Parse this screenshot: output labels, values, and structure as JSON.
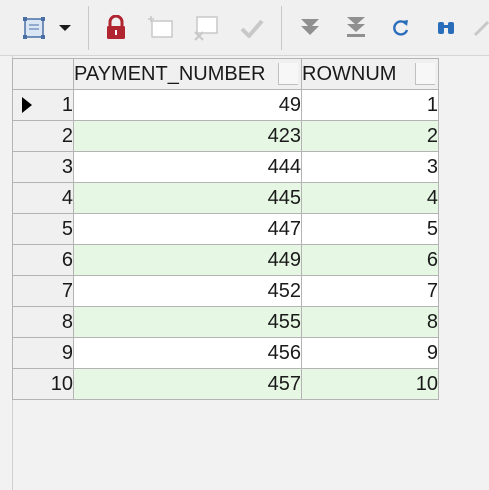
{
  "toolbar": {
    "icons": [
      "grid-select-icon",
      "dropdown-arrow-icon",
      "lock-icon",
      "insert-record-icon",
      "delete-record-icon",
      "post-edit-icon",
      "next-record-icon",
      "last-record-icon",
      "refresh-icon",
      "find-icon",
      "edit-icon"
    ],
    "colors": {
      "lock": "#b0252f",
      "nav": "#909090",
      "refresh": "#2a6ebb",
      "find": "#2a6ebb",
      "disabled": "#c8c8c8"
    }
  },
  "grid": {
    "columns": [
      "PAYMENT_NUMBER",
      "ROWNUM"
    ],
    "current_row": 1,
    "rows": [
      {
        "num": "1",
        "payment_number": "49",
        "rownum": "1"
      },
      {
        "num": "2",
        "payment_number": "423",
        "rownum": "2"
      },
      {
        "num": "3",
        "payment_number": "444",
        "rownum": "3"
      },
      {
        "num": "4",
        "payment_number": "445",
        "rownum": "4"
      },
      {
        "num": "5",
        "payment_number": "447",
        "rownum": "5"
      },
      {
        "num": "6",
        "payment_number": "449",
        "rownum": "6"
      },
      {
        "num": "7",
        "payment_number": "452",
        "rownum": "7"
      },
      {
        "num": "8",
        "payment_number": "455",
        "rownum": "8"
      },
      {
        "num": "9",
        "payment_number": "456",
        "rownum": "9"
      },
      {
        "num": "10",
        "payment_number": "457",
        "rownum": "10"
      }
    ],
    "colors": {
      "alt_row": "#e6f8e4",
      "header": "#f0f0f0",
      "border": "#b4b4b4"
    }
  }
}
